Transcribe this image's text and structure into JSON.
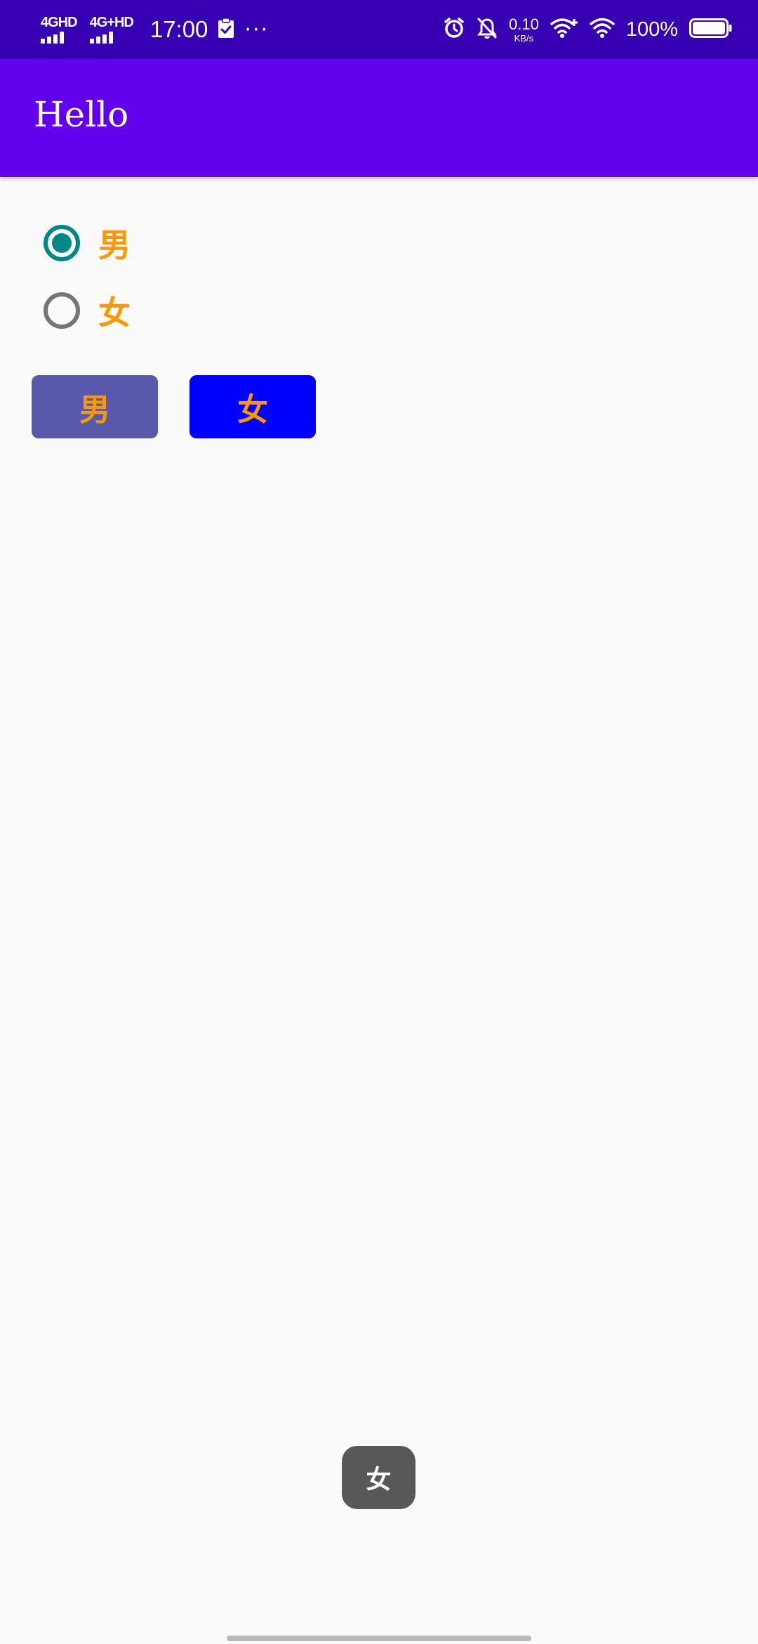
{
  "status_bar": {
    "net1": "4GHD",
    "net2": "4G+HD",
    "time": "17:00",
    "more": "···",
    "speed_value": "0.10",
    "speed_unit": "KB/s",
    "battery": "100%"
  },
  "app_bar": {
    "title": "Hello"
  },
  "radios": [
    {
      "label": "男",
      "checked": true
    },
    {
      "label": "女",
      "checked": false
    }
  ],
  "buttons": {
    "male_label": "男",
    "female_label": "女"
  },
  "toast": {
    "text": "女"
  },
  "colors": {
    "status_bar": "#3700b3",
    "app_bar": "#6200ee",
    "radio_checked": "#018786",
    "radio_unchecked": "#757575",
    "label_orange": "#ff9800",
    "male_button": "#5859ab",
    "female_button": "#0000fe",
    "toast": "#585858",
    "background": "#fafafa"
  }
}
